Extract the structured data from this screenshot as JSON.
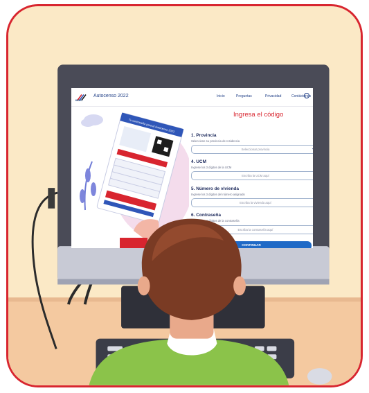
{
  "header": {
    "logo_text": "INEC",
    "app_title": "Autocenso 2022",
    "nav_items": [
      {
        "label": "Inicio"
      },
      {
        "label": "Preguntas"
      },
      {
        "label": "Privacidad"
      },
      {
        "label": "Contáctenos"
      }
    ]
  },
  "form": {
    "title": "Ingresa el código",
    "fields": [
      {
        "label": "1. Provincia",
        "hint": "Seleccione su provincia de residencia",
        "value": "Seleccionar provincia",
        "type": "select"
      },
      {
        "label": "4. UCM",
        "hint": "Ingrese los 3 dígitos de la UCM",
        "value": "Escriba la UCM aquí",
        "type": "text"
      },
      {
        "label": "5. Número de vivienda",
        "hint": "Ingrese los 3 dígitos del número asignado",
        "value": "Escriba la vivienda aquí",
        "type": "text"
      },
      {
        "label": "6. Contraseña",
        "hint": "Ingrese los 4 dígitos de la contraseña",
        "value": "Escriba la contraseña aquí",
        "type": "text"
      }
    ],
    "submit_label": "CONTINUAR"
  },
  "flyer": {
    "title": "Tu contraseña para el Autocenso 2022"
  },
  "colors": {
    "frame": "#d8252f",
    "background": "#fbe9c6",
    "accent_red": "#d8252f",
    "accent_blue": "#1f69c6",
    "monitor": "#4a4b57",
    "hair": "#7a3b24",
    "shirt": "#8bc34a"
  }
}
